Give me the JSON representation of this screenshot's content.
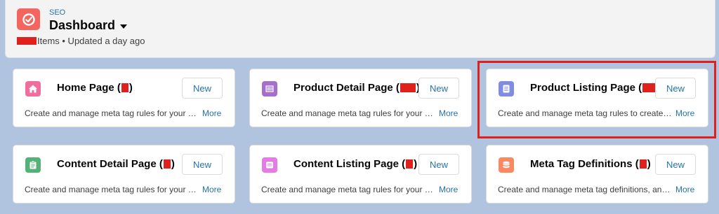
{
  "header": {
    "app_name": "SEO",
    "title": "Dashboard",
    "subtitle_suffix": "Items • Updated a day ago"
  },
  "cards": [
    {
      "title": "Home Page (",
      "title_end": ")",
      "new_label": "New",
      "description": "Create and manage meta tag rules for your home page",
      "more_label": "More",
      "icon": "home-icon",
      "icon_color": "#ef6e9e"
    },
    {
      "title": "Product Detail Page (",
      "title_end": ")",
      "new_label": "New",
      "description": "Create and manage meta tag rules for your product detail pages",
      "more_label": "More",
      "icon": "barcode-icon",
      "icon_color": "#a570c9"
    },
    {
      "title": "Product Listing Page (",
      "title_end": "",
      "new_label": "New",
      "description": "Create and manage meta tag rules to create product listing pages",
      "more_label": "More",
      "icon": "list-icon",
      "icon_color": "#7f8de1"
    },
    {
      "title": "Content Detail Page (",
      "title_end": ")",
      "new_label": "New",
      "description": "Create and manage meta tag rules for your content detail pages",
      "more_label": "More",
      "icon": "clipboard-icon",
      "icon_color": "#54b276"
    },
    {
      "title": "Content Listing Page (",
      "title_end": ")",
      "new_label": "New",
      "description": "Create and manage meta tag rules for your content listing pages",
      "more_label": "More",
      "icon": "list-icon",
      "icon_color": "#e47ce4"
    },
    {
      "title": "Meta Tag Definitions (",
      "title_end": ")",
      "new_label": "New",
      "description": "Create and manage meta tag definitions, and more",
      "more_label": "More",
      "icon": "database-icon",
      "icon_color": "#f88962"
    }
  ]
}
